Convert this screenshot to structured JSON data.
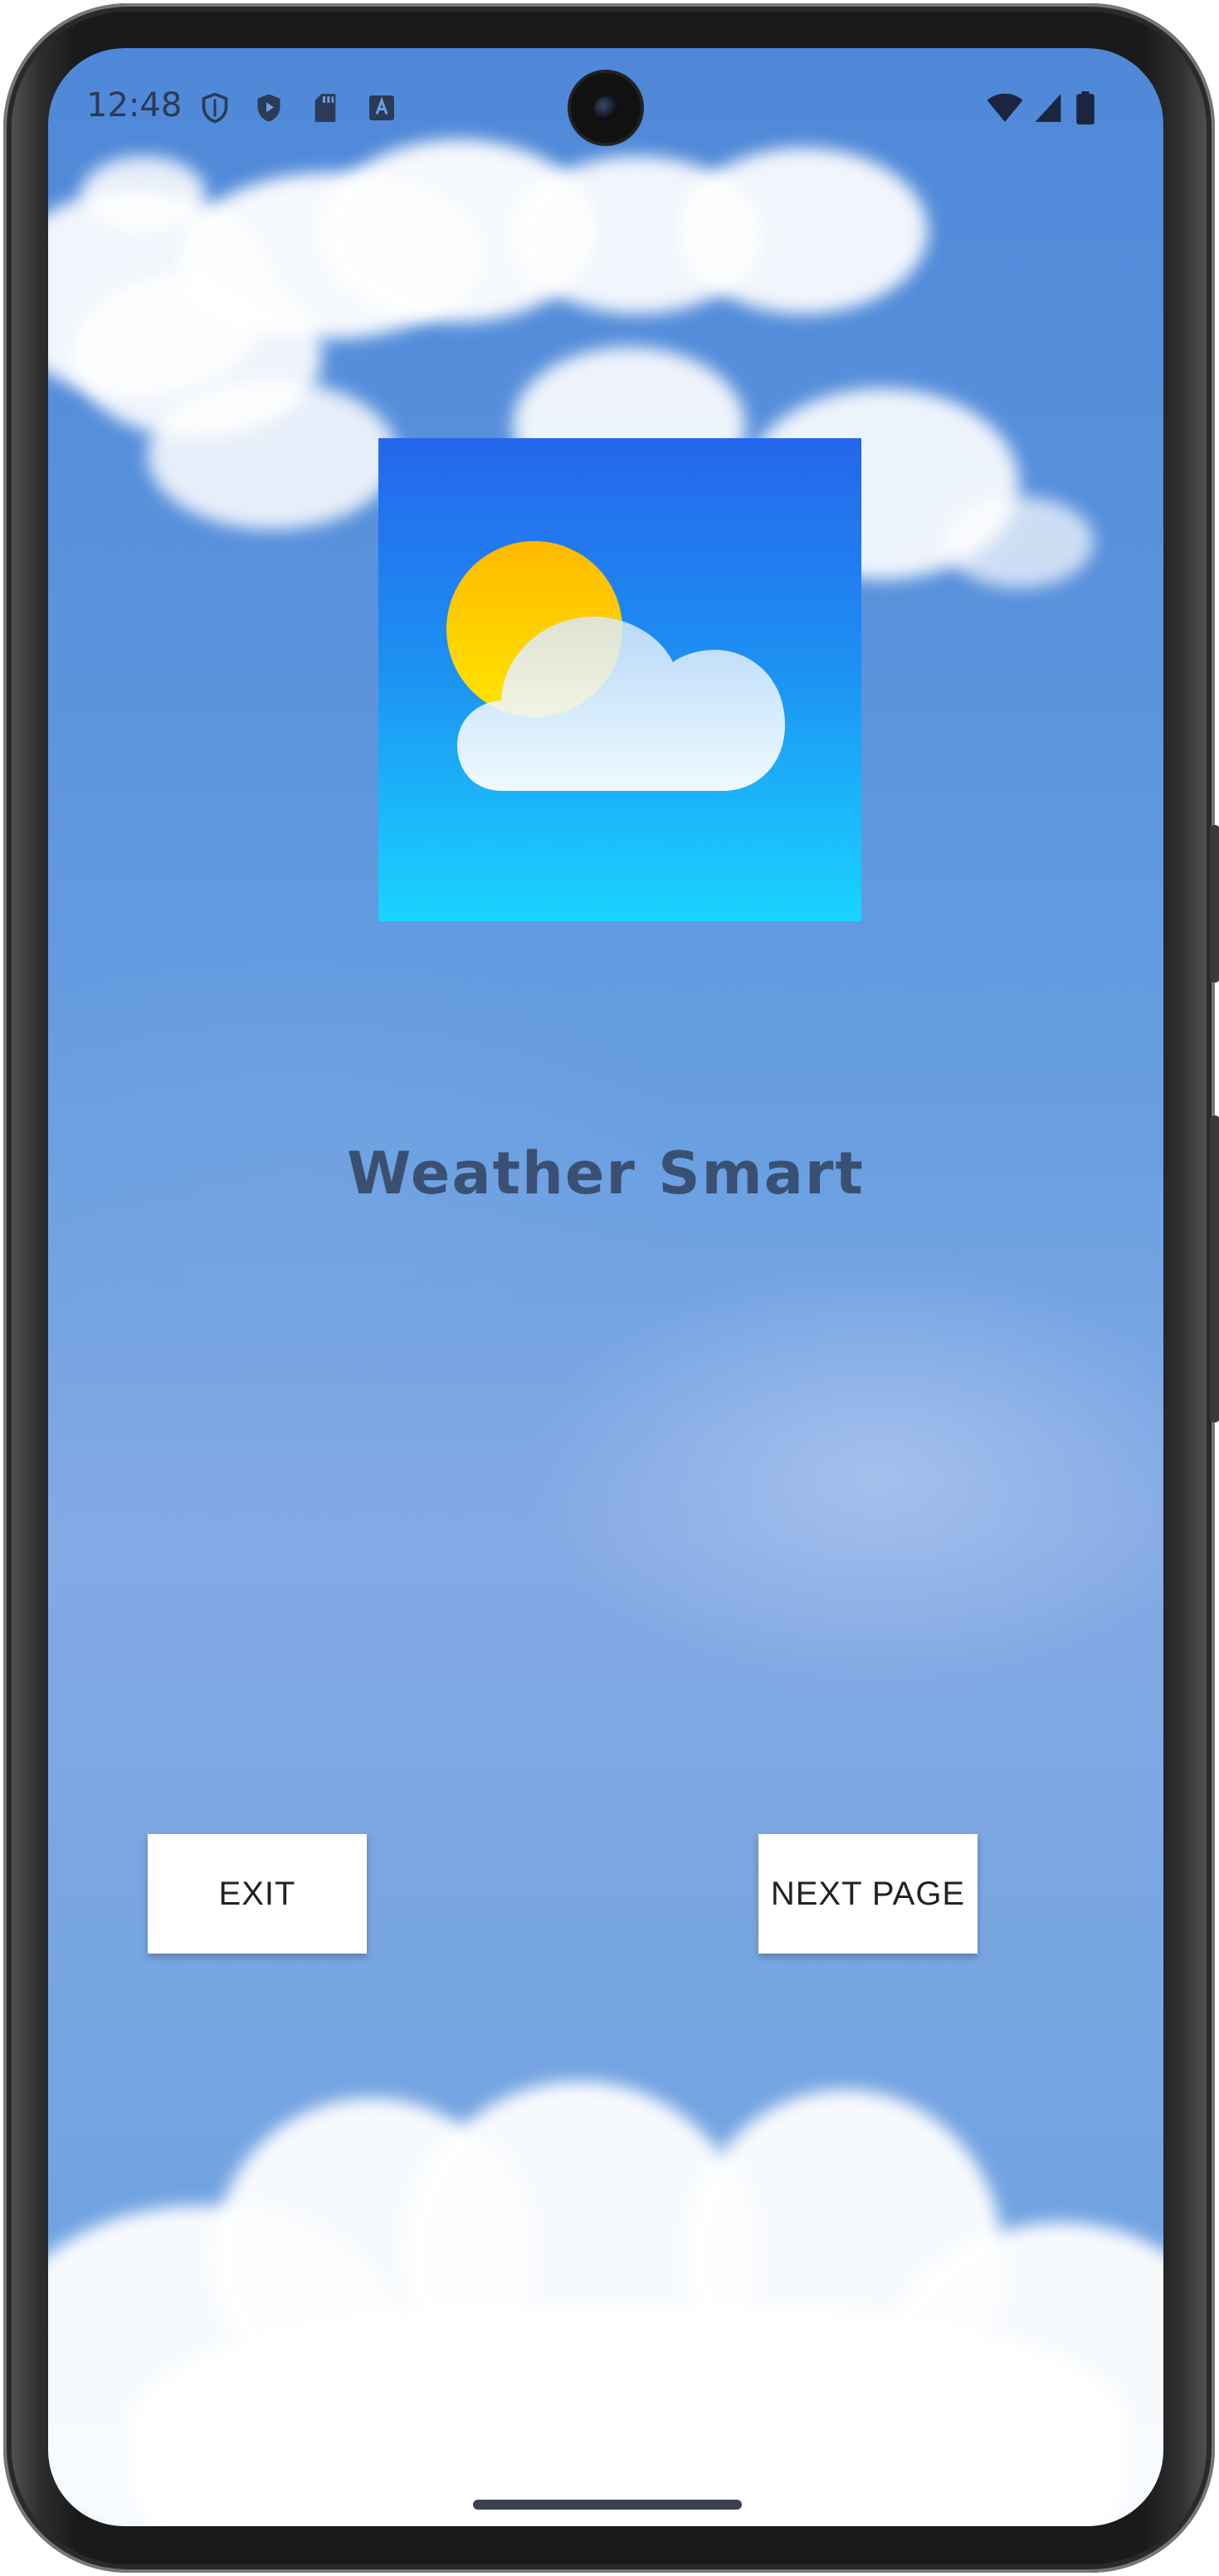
{
  "status_bar": {
    "time": "12:48",
    "left_icons": [
      "shield-outline-icon",
      "shield-play-icon",
      "sd-card-icon",
      "keyboard-a-icon"
    ],
    "right_icons": [
      "wifi-icon",
      "cell-signal-icon",
      "battery-icon"
    ]
  },
  "app": {
    "logo_icon": "sun-cloud-icon",
    "title": "Weather Smart",
    "title_color": "#3a5073"
  },
  "buttons": {
    "exit_label": "EXIT",
    "next_page_label": "NEXT PAGE"
  },
  "colors": {
    "sky": "#5b93dc",
    "logo_top": "#2566ec",
    "logo_bottom": "#1ad4ff",
    "sun": "#ffc400",
    "button_bg": "#ffffff"
  }
}
